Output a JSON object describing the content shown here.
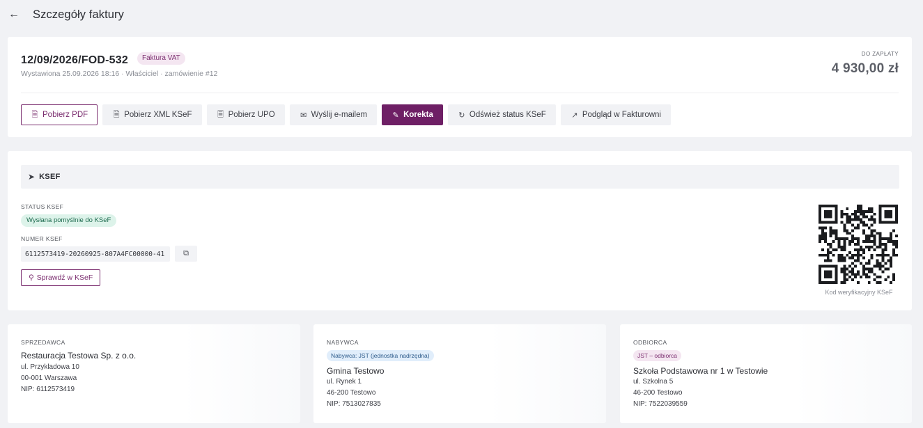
{
  "header": {
    "back_icon": "arrow-left-icon",
    "title": "Szczegóły faktury"
  },
  "invoice": {
    "number": "12/09/2026/FOD-532",
    "type_badge": "Faktura VAT",
    "issued_line": "Wystawiona 25.09.2026 18:16 · Właściciel · zamówienie #12",
    "due_label": "DO ZAPŁATY",
    "due_amount": "4 930,00 zł",
    "actions": [
      {
        "label": "Pobierz PDF",
        "icon": "file-pdf-icon",
        "style": "outline"
      },
      {
        "label": "Pobierz XML KSeF",
        "icon": "file-code-icon",
        "style": "default"
      },
      {
        "label": "Pobierz UPO",
        "icon": "receipt-icon",
        "style": "default"
      },
      {
        "label": "Wyślij e-mailem",
        "icon": "envelope-icon",
        "style": "default"
      },
      {
        "label": "Korekta",
        "icon": "edit-icon",
        "style": "primary"
      },
      {
        "label": "Odśwież status KSeF",
        "icon": "refresh-icon",
        "style": "default"
      },
      {
        "label": "Podgląd w Fakturowni",
        "icon": "external-link-icon",
        "style": "default"
      }
    ]
  },
  "ksef": {
    "title": "KSEF",
    "icon": "send-icon",
    "status_label": "STATUS KSEF",
    "status_value": "Wysłana pomyślnie do KSeF",
    "number_label": "NUMER KSEF",
    "number_value": "6112573419-20260925-807A4FC00000-41",
    "copy_icon": "copy-icon",
    "check_button": "Sprawdź w KSeF",
    "check_icon": "search-icon",
    "qr_caption": "Kod weryfikacyjny KSeF",
    "colors": {
      "accent": "#6e1f65",
      "success_bg": "#ddf3ea",
      "success_text": "#1e6b4f"
    }
  },
  "parties": {
    "seller": {
      "label": "SPRZEDAWCA",
      "name": "Restauracja Testowa Sp. z o.o.",
      "street": "ul. Przykladowa 10",
      "city": "00-001 Warszawa",
      "nip": "NIP: 6112573419"
    },
    "buyer": {
      "label": "NABYWCA",
      "badge": "Nabywca: JST (jednostka nadrzędna)",
      "name": "Gmina Testowo",
      "street": "ul. Rynek 1",
      "city": "46-200 Testowo",
      "nip": "NIP: 7513027835"
    },
    "recipient": {
      "label": "ODBIORCA",
      "badge": "JST – odbiorca",
      "name": "Szkoła Podstawowa nr 1 w Testowie",
      "street": "ul. Szkolna 5",
      "city": "46-200 Testowo",
      "nip": "NIP: 7522039559"
    }
  }
}
